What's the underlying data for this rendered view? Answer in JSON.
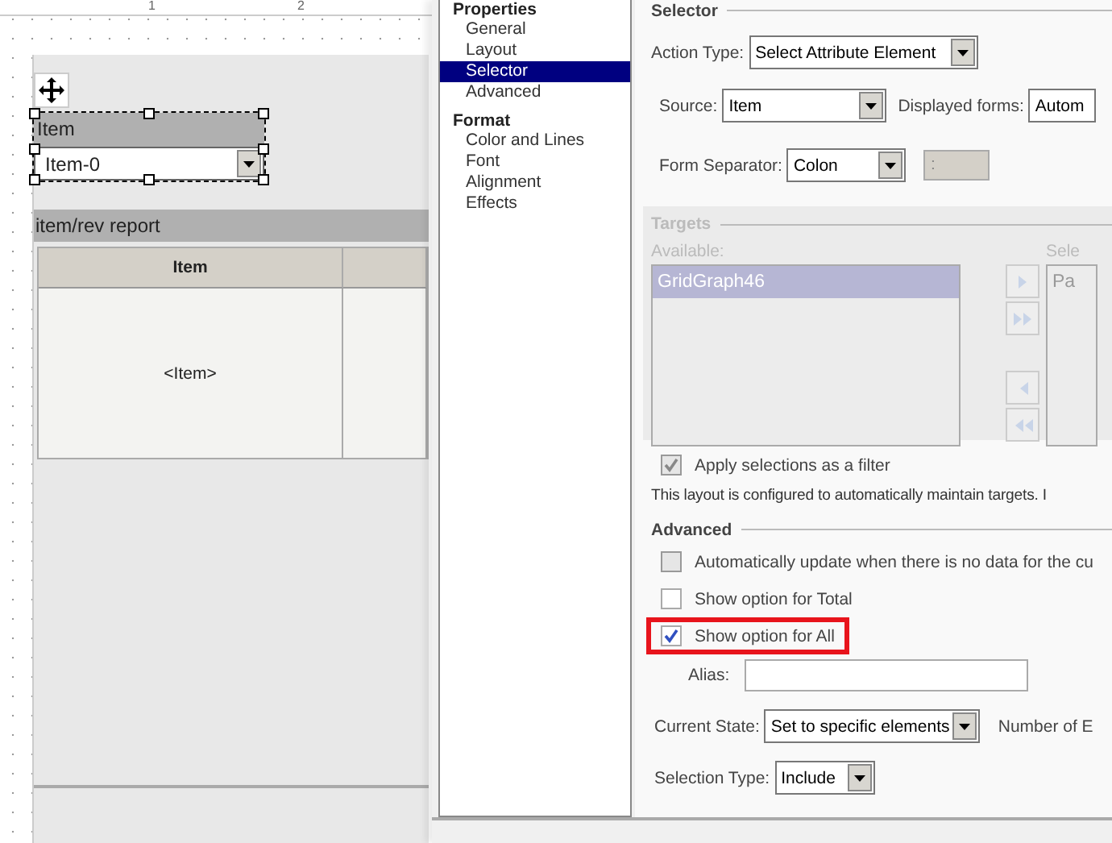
{
  "canvas": {
    "ruler_marks": [
      "1",
      "2"
    ],
    "selector_widget": {
      "label": "Item",
      "value": "Item-0",
      "selected": true
    },
    "report": {
      "title": "item/rev report",
      "columns": [
        {
          "label": "Item"
        }
      ],
      "rows": [
        [
          "<Item>"
        ]
      ]
    }
  },
  "dialog": {
    "nav": [
      {
        "label": "Properties",
        "kind": "group",
        "children": [
          {
            "label": "General",
            "selected": false
          },
          {
            "label": "Layout",
            "selected": false
          },
          {
            "label": "Selector",
            "selected": true
          },
          {
            "label": "Advanced",
            "selected": false
          }
        ]
      },
      {
        "label": "Format",
        "kind": "group",
        "children": [
          {
            "label": "Color and Lines",
            "selected": false
          },
          {
            "label": "Font",
            "selected": false
          },
          {
            "label": "Alignment",
            "selected": false
          },
          {
            "label": "Effects",
            "selected": false
          }
        ]
      }
    ],
    "selector": {
      "title": "Selector",
      "action_type": {
        "label": "Action Type:",
        "value": "Select Attribute Element"
      },
      "source": {
        "label": "Source:",
        "value": "Item"
      },
      "displayed_forms": {
        "label": "Displayed forms:",
        "value": "Autom"
      },
      "form_separator": {
        "label": "Form Separator:",
        "value": "Colon"
      },
      "separator_value": ":"
    },
    "targets": {
      "title": "Targets",
      "disabled": true,
      "available_label": "Available:",
      "available": [
        {
          "label": "GridGraph46",
          "selected": true
        }
      ],
      "selected_label": "Sele",
      "selected_items": [
        "Pa"
      ]
    },
    "apply_filter": {
      "label": "Apply selections as a filter",
      "checked": true,
      "disabled": true
    },
    "note": "This layout is configured to automatically maintain targets. I",
    "advanced": {
      "title": "Advanced",
      "options": [
        {
          "label": "Automatically update when there is no data for the cu",
          "checked": false,
          "disabled": true,
          "highlighted": false
        },
        {
          "label": "Show option for Total",
          "checked": false,
          "disabled": false,
          "highlighted": false
        },
        {
          "label": "Show option for All",
          "checked": true,
          "disabled": false,
          "highlighted": true
        }
      ],
      "alias": {
        "label": "Alias:"
      },
      "current_state": {
        "label": "Current State:",
        "value": "Set to specific elements"
      },
      "number_label": "Number of E",
      "selection_type": {
        "label": "Selection Type:",
        "value": "Include"
      }
    }
  }
}
